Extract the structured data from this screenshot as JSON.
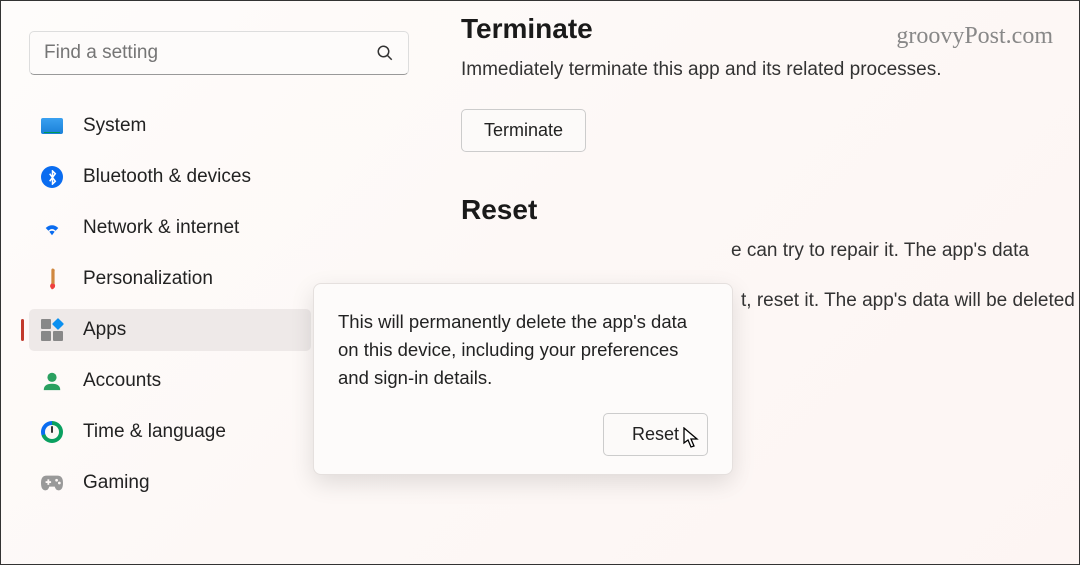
{
  "watermark": "groovyPost.com",
  "search": {
    "placeholder": "Find a setting"
  },
  "sidebar": {
    "items": [
      {
        "label": "System"
      },
      {
        "label": "Bluetooth & devices"
      },
      {
        "label": "Network & internet"
      },
      {
        "label": "Personalization"
      },
      {
        "label": "Apps"
      },
      {
        "label": "Accounts"
      },
      {
        "label": "Time & language"
      },
      {
        "label": "Gaming"
      }
    ]
  },
  "main": {
    "terminate": {
      "heading": "Terminate",
      "desc": "Immediately terminate this app and its related processes.",
      "button": "Terminate"
    },
    "reset": {
      "heading": "Reset",
      "repair_partial": "e can try to repair it. The app's data",
      "reset_partial": "t, reset it. The app's data will be deleted",
      "button": "Reset"
    }
  },
  "flyout": {
    "text": "This will permanently delete the app's data on this device, including your preferences and sign-in details.",
    "confirm": "Reset"
  }
}
